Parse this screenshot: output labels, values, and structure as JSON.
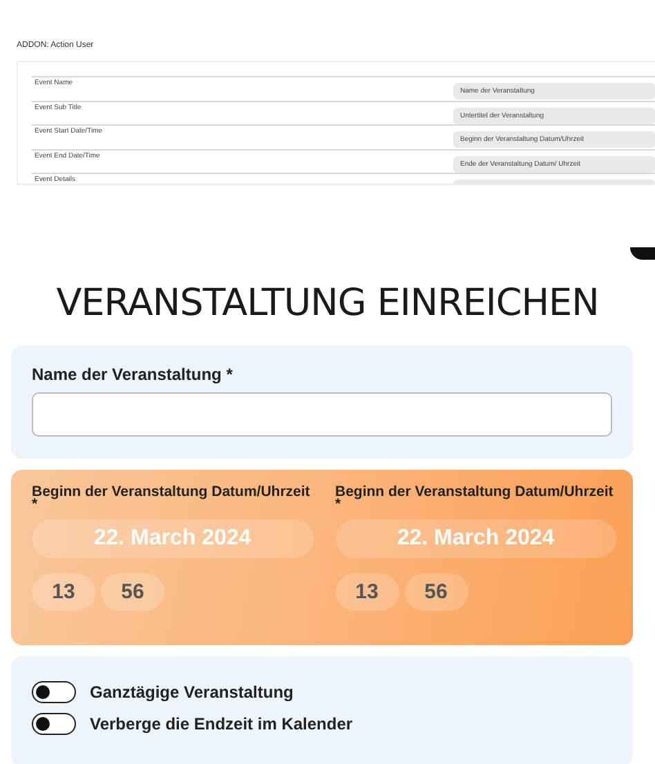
{
  "addon": {
    "title": "ADDON: Action User",
    "rows": [
      {
        "label": "Event Name",
        "value": "Name der Veranstaltung"
      },
      {
        "label": "Event Sub Title",
        "value": "Untertitel der Veranstaltung"
      },
      {
        "label": "Event Start Date/Time",
        "value": "Beginn der Veranstaltung Datum/Uhrzeit"
      },
      {
        "label": "Event End Date/Time",
        "value": "Ende der Veranstaltung Datum/ Uhrzeit"
      },
      {
        "label": "Event Details"
      }
    ]
  },
  "heading": "VERANSTALTUNG EINREICHEN",
  "name_field": {
    "label": "Name der Veranstaltung *"
  },
  "dates": [
    {
      "label": "Beginn der Veranstaltung Datum/Uhrzeit",
      "required": "*",
      "date": "22. March 2024",
      "hour": "13",
      "minute": "56"
    },
    {
      "label": "Beginn der Veranstaltung Datum/Uhrzeit",
      "required": "*",
      "date": "22. March 2024",
      "hour": "13",
      "minute": "56"
    }
  ],
  "toggles": [
    {
      "label": "Ganztägige Veranstaltung",
      "on": false
    },
    {
      "label": "Verberge die Endzeit im Kalender",
      "on": false
    }
  ]
}
